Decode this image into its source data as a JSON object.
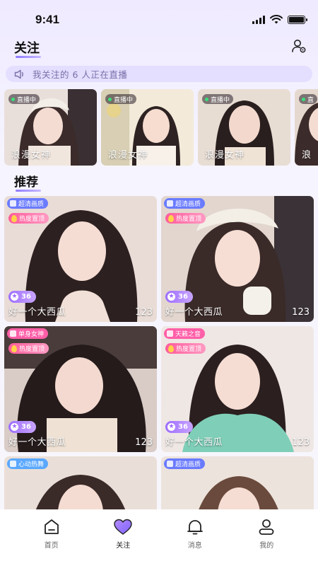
{
  "status": {
    "time": "9:41"
  },
  "header": {
    "title": "关注"
  },
  "live_notice": {
    "text": "我关注的 6 人正在直播"
  },
  "live_cards": [
    {
      "badge": "直播中",
      "name": "浪漫女神"
    },
    {
      "badge": "直播中",
      "name": "浪漫女神"
    },
    {
      "badge": "直播中",
      "name": "浪漫女神"
    },
    {
      "badge": "直",
      "name": "浪"
    }
  ],
  "recommend": {
    "title": "推荐",
    "cards": [
      {
        "tag": "超清画质",
        "tag_color": "#6a7bff",
        "hot": "热度置顶",
        "rating": "36",
        "name": "好一个大西瓜",
        "count": "123"
      },
      {
        "tag": "超清画质",
        "tag_color": "#6a7bff",
        "hot": "热度置顶",
        "rating": "36",
        "name": "好一个大西瓜",
        "count": "123"
      },
      {
        "tag": "单身女神",
        "tag_color": "#ff5fa8",
        "hot": "热度置顶",
        "rating": "36",
        "name": "好一个大西瓜",
        "count": "123"
      },
      {
        "tag": "天籁之音",
        "tag_color": "#ff5fa8",
        "hot": "热度置顶",
        "rating": "36",
        "name": "好一个大西瓜",
        "count": "123"
      },
      {
        "tag": "心动热舞",
        "tag_color": "#5aa8ff",
        "hot": "",
        "rating": "",
        "name": "",
        "count": ""
      },
      {
        "tag": "超清画质",
        "tag_color": "#6a7bff",
        "hot": "",
        "rating": "",
        "name": "",
        "count": ""
      }
    ]
  },
  "tabbar": {
    "items": [
      {
        "label": "首页",
        "icon": "home-icon"
      },
      {
        "label": "关注",
        "icon": "heart-icon"
      },
      {
        "label": "消息",
        "icon": "bell-icon"
      },
      {
        "label": "我的",
        "icon": "user-icon"
      }
    ]
  }
}
